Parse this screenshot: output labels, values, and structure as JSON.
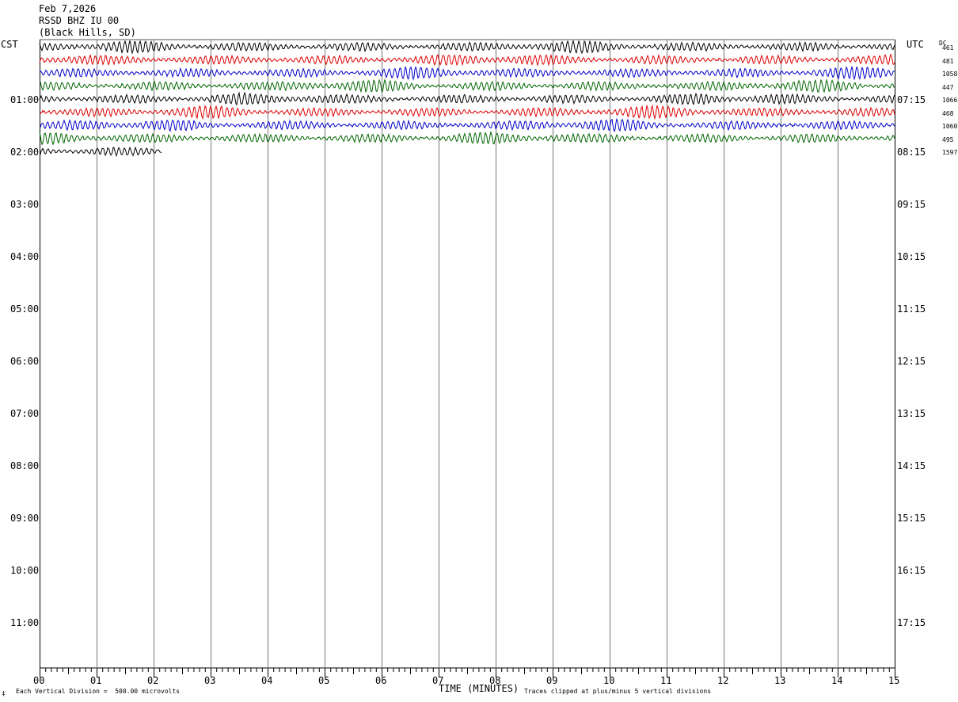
{
  "header": {
    "date": "Feb 7,2026",
    "station": "RSSD BHZ IU 00",
    "location": "(Black Hills, SD)"
  },
  "left_axis": {
    "label": "CST"
  },
  "right_axis": {
    "label": "UTC",
    "dc_label": "DC"
  },
  "footer": {
    "scale_note": "Each Vertical Division =  500.00 microvolts",
    "clip_note": "Traces clipped at plus/minus 5 vertical divisions",
    "mark": "‡"
  },
  "chart_data": {
    "type": "line",
    "xlabel": "TIME (MINUTES)",
    "x_ticks": [
      "00",
      "01",
      "02",
      "03",
      "04",
      "05",
      "06",
      "07",
      "08",
      "09",
      "10",
      "11",
      "12",
      "13",
      "14",
      "15"
    ],
    "xlim": [
      0,
      15
    ],
    "grid": "vertical lines at each minute",
    "rows_local": [
      "01:00",
      "02:00",
      "03:00",
      "04:00",
      "05:00",
      "06:00",
      "07:00",
      "08:00",
      "09:00",
      "10:00",
      "11:00"
    ],
    "rows_utc": [
      "07:15",
      "08:15",
      "09:15",
      "10:15",
      "11:15",
      "12:15",
      "13:15",
      "14:15",
      "15:15",
      "16:15",
      "17:15"
    ],
    "trace_colors": [
      "#000000",
      "#dd0000",
      "#0000cc",
      "#006600"
    ],
    "traces": [
      {
        "row": 0,
        "color": "#000000",
        "minutes": 15,
        "dc": "461"
      },
      {
        "row": 1,
        "color": "#dd0000",
        "minutes": 15,
        "dc": "481"
      },
      {
        "row": 2,
        "color": "#0000cc",
        "minutes": 15,
        "dc": "1058"
      },
      {
        "row": 3,
        "color": "#006600",
        "minutes": 15,
        "dc": "447"
      },
      {
        "row": 4,
        "color": "#000000",
        "minutes": 15,
        "dc": "1066"
      },
      {
        "row": 5,
        "color": "#dd0000",
        "minutes": 15,
        "dc": "468"
      },
      {
        "row": 6,
        "color": "#0000cc",
        "minutes": 15,
        "dc": "1060"
      },
      {
        "row": 7,
        "color": "#006600",
        "minutes": 15,
        "dc": "495"
      },
      {
        "row": 8,
        "color": "#000000",
        "minutes": 2.15,
        "dc": "1597"
      }
    ]
  }
}
